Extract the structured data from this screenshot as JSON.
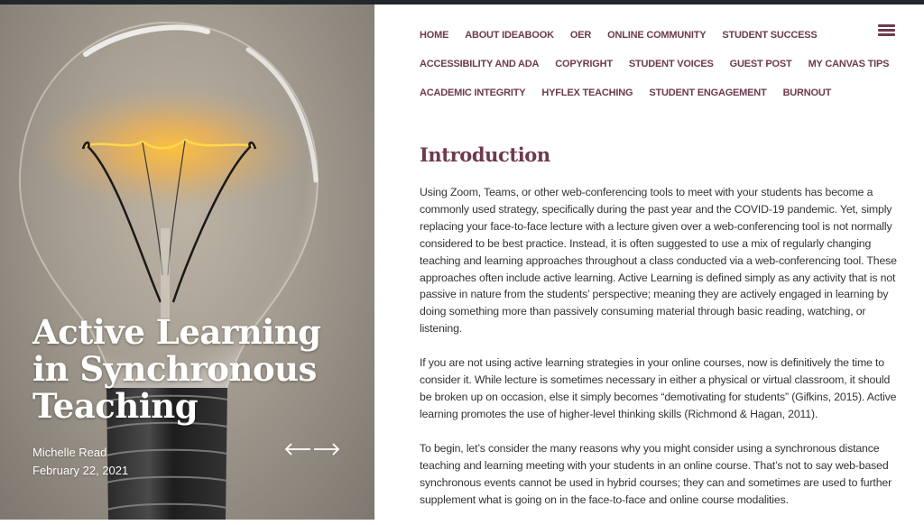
{
  "colors": {
    "accent": "#6d3a4e",
    "text": "#333333",
    "topbar": "#23282d",
    "hero_text": "#ffffff"
  },
  "nav": {
    "rows": [
      [
        "HOME",
        "ABOUT IDEABOOK",
        "OER",
        "ONLINE COMMUNITY",
        "STUDENT SUCCESS"
      ],
      [
        "ACCESSIBILITY AND ADA",
        "COPYRIGHT",
        "STUDENT VOICES",
        "GUEST POST",
        "MY CANVAS TIPS"
      ],
      [
        "ACADEMIC INTEGRITY",
        "HYFLEX TEACHING",
        "STUDENT ENGAGEMENT",
        "BURNOUT"
      ]
    ],
    "menu_icon": "hamburger-icon"
  },
  "hero": {
    "title_lines": [
      "Active Learning",
      "in Synchronous",
      "Teaching"
    ],
    "author": "Michelle Read",
    "date": "February 22, 2021",
    "nav_icon": "prev-next-arrows-icon",
    "image": "light-bulb-photo"
  },
  "article": {
    "heading": "Introduction",
    "paragraphs": [
      "Using Zoom, Teams, or other web-conferencing tools to meet with your students has become a commonly used strategy, specifically during the past year and the COVID-19 pandemic. Yet, simply replacing your face-to-face lecture with a lecture given over a web-conferencing tool is not normally considered to be best practice. Instead, it is often suggested to use a mix of regularly changing teaching and learning approaches throughout a class conducted via a web-conferencing tool. These approaches often include active learning. Active Learning is defined simply as any activity that is not passive in nature from the students’ perspective; meaning they are actively engaged in learning by doing something more than passively consuming material through basic reading, watching, or listening.",
      "If you are not using active learning strategies in your online courses, now is definitively the time to consider it. While lecture is sometimes necessary in either a physical or virtual classroom, it should be broken up on occasion, else it simply becomes “demotivating for students” (Gifkins, 2015). Active learning promotes the use of higher-level thinking skills (Richmond & Hagan, 2011).",
      "To begin, let’s consider the many reasons why you might consider using a synchronous distance teaching and learning meeting with your students in an online course. That’s not to say web-based synchronous events cannot be used in hybrid courses; they can and sometimes are used to further supplement what is going on in the face-to-face and online course modalities."
    ]
  }
}
